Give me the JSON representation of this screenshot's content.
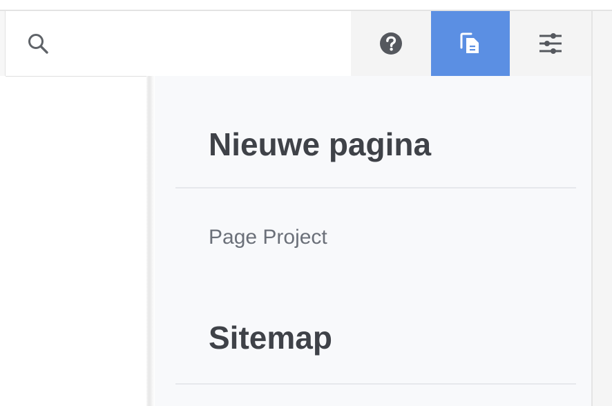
{
  "toolbar": {
    "search_icon": "search-icon",
    "help_icon": "help-circle-icon",
    "pages_icon": "pages-icon",
    "settings_icon": "sliders-icon",
    "active_color": "#5b8fe3"
  },
  "panel": {
    "section_1_title": "Nieuwe pagina",
    "section_1_items": [
      "Page Project"
    ],
    "section_2_title": "Sitemap"
  }
}
